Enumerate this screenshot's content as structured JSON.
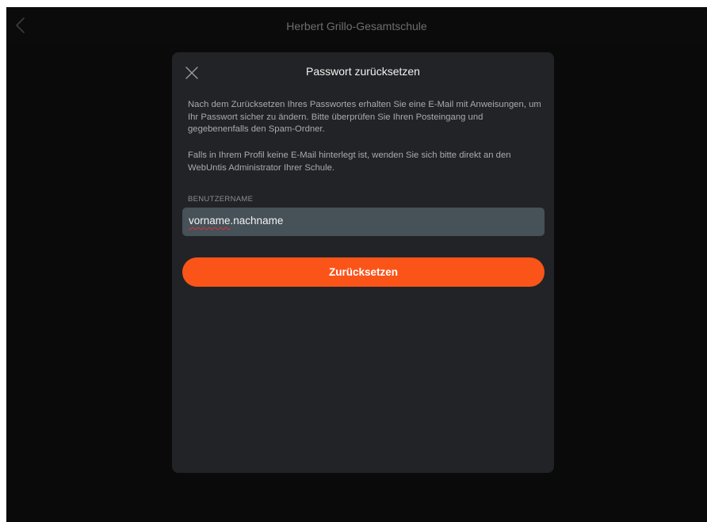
{
  "header": {
    "title": "Herbert Grillo-Gesamtschule"
  },
  "modal": {
    "title": "Passwort zurücksetzen",
    "paragraph1": "Nach dem Zurücksetzen Ihres Passwortes erhalten Sie eine E-Mail mit Anweisungen, um Ihr Passwort sicher zu ändern. Bitte überprüfen Sie Ihren Posteingang und gegebenenfalls den Spam-Ordner.",
    "paragraph2": "Falls in Ihrem Profil keine E-Mail hinterlegt ist, wenden Sie sich bitte direkt an den WebUntis Administrator Ihrer Schule.",
    "username_label": "BENUTZERNAME",
    "username_value_part1": "vorname",
    "username_value_part2": ".nachname",
    "reset_label": "Zurücksetzen"
  },
  "icons": {
    "back": "chevron-left-icon",
    "close": "close-icon"
  },
  "colors": {
    "accent": "#fb5419",
    "modal_bg": "#222326",
    "input_bg": "#465158",
    "screen_bg": "#0a0a0a"
  }
}
